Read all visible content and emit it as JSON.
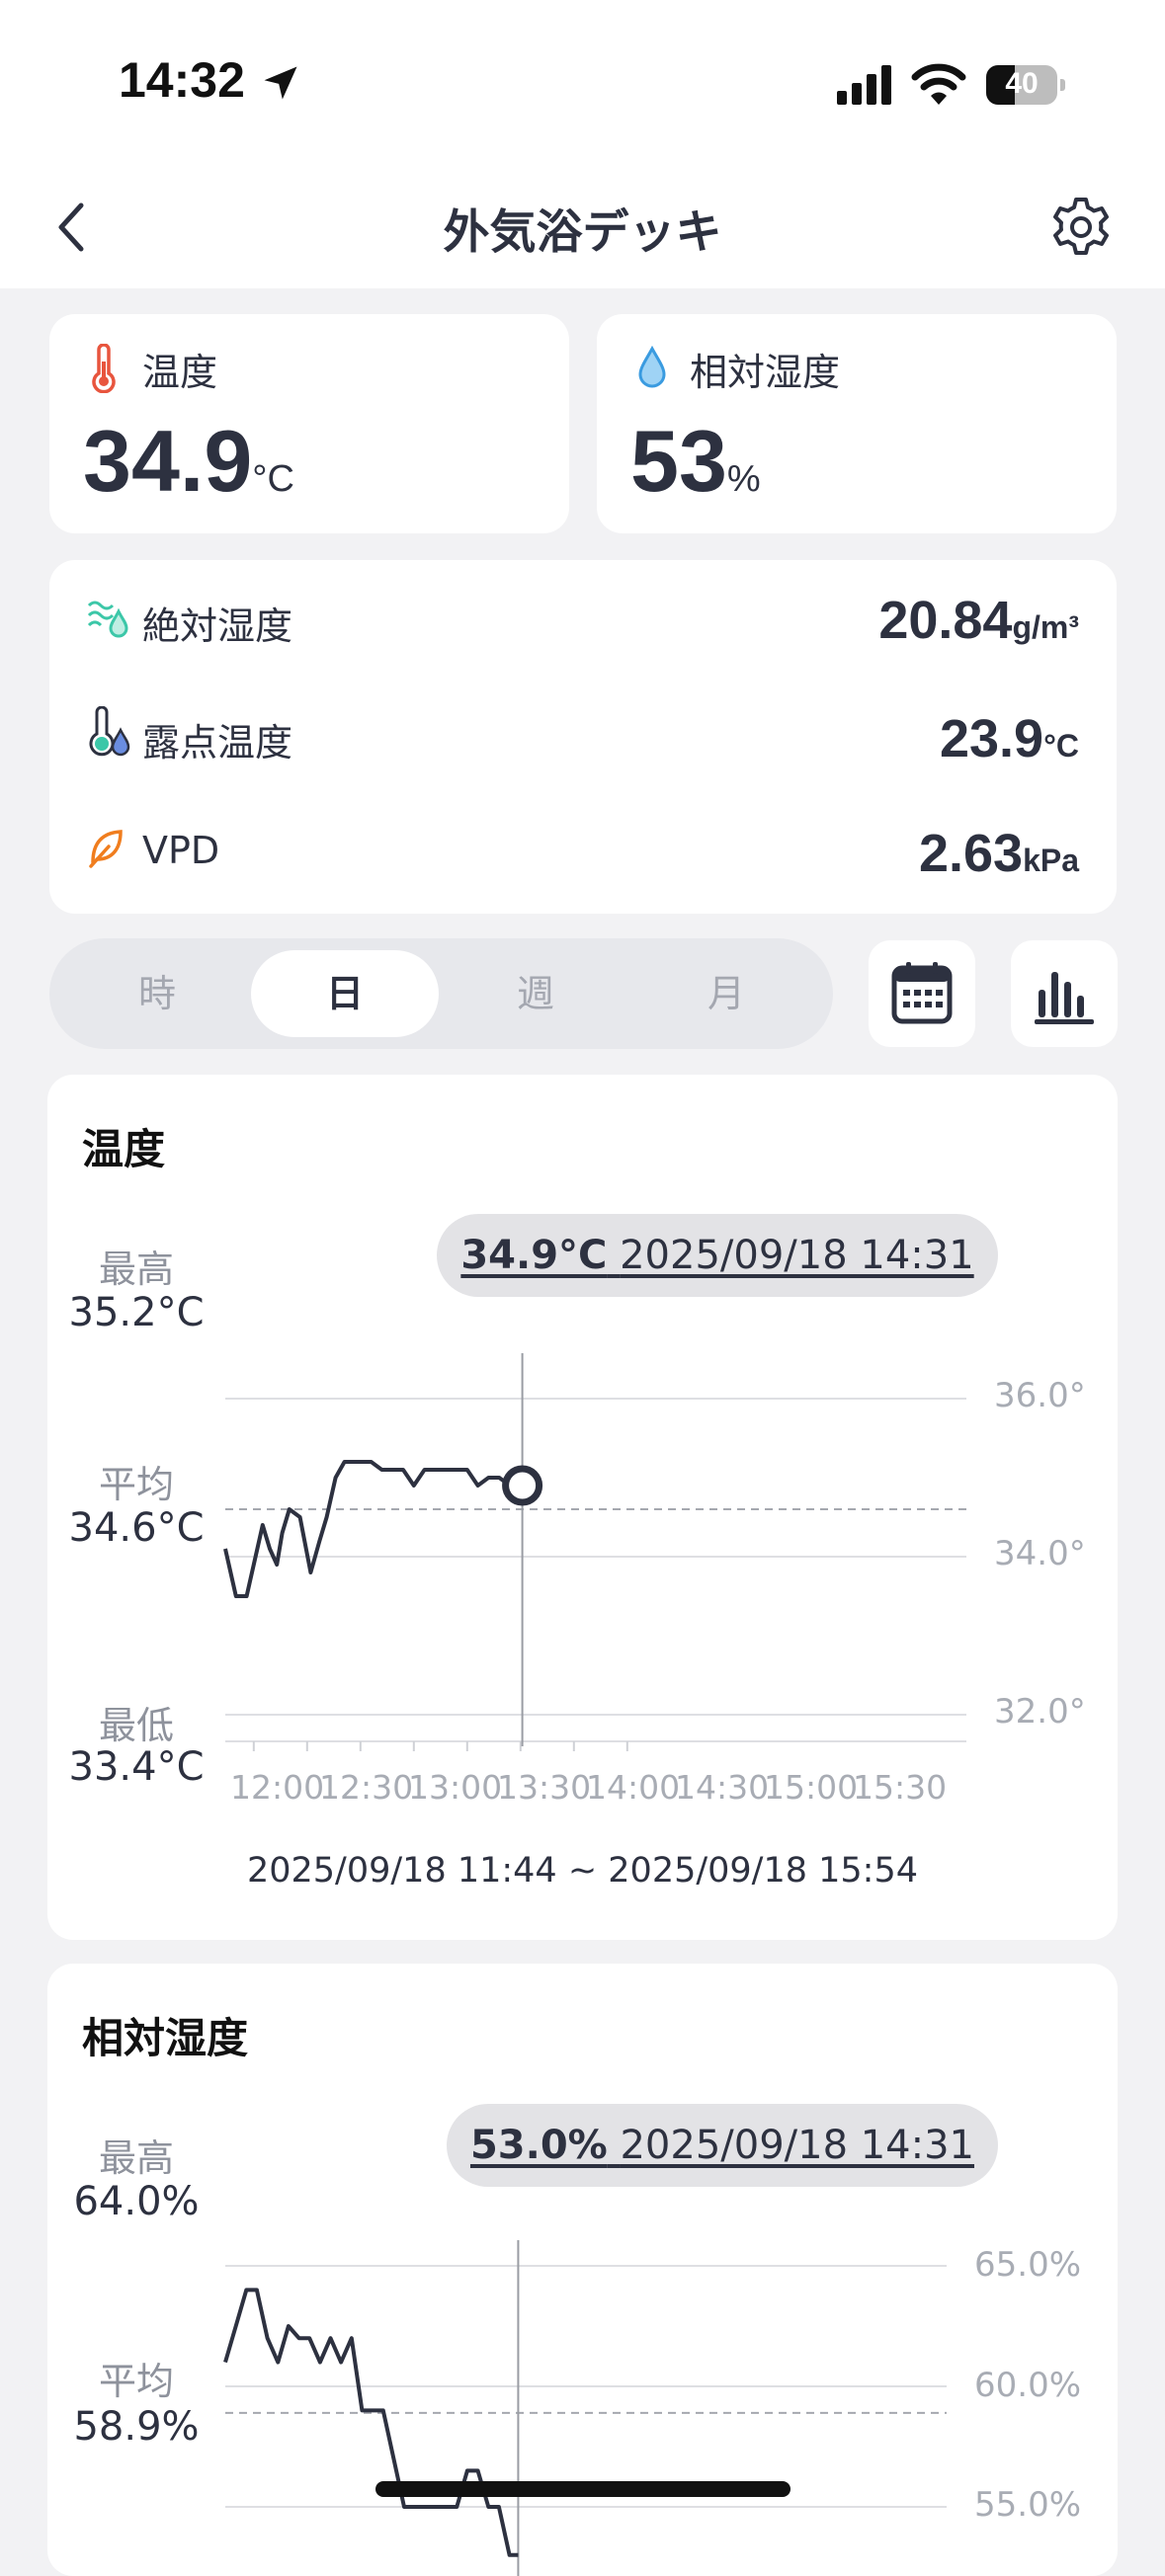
{
  "status_bar": {
    "time": "14:32",
    "battery": "40"
  },
  "nav": {
    "title": "外気浴デッキ"
  },
  "temperature_card": {
    "label": "温度",
    "value": "34.9",
    "unit": "°C"
  },
  "humidity_card": {
    "label": "相対湿度",
    "value": "53",
    "unit": "%"
  },
  "metrics": [
    {
      "label": "絶対湿度",
      "value": "20.84",
      "unit": "g/m³",
      "icon": "humidity-waves-icon"
    },
    {
      "label": "露点温度",
      "value": "23.9",
      "unit": "°C",
      "icon": "dew-point-icon"
    },
    {
      "label": "VPD",
      "value": "2.63",
      "unit": "kPa",
      "icon": "leaf-icon"
    }
  ],
  "period_tabs": [
    {
      "label": "時",
      "active": false
    },
    {
      "label": "日",
      "active": true
    },
    {
      "label": "週",
      "active": false
    },
    {
      "label": "月",
      "active": false
    }
  ],
  "temp_chart": {
    "title": "温度",
    "max_label": "最高",
    "max_value": "35.2°C",
    "avg_label": "平均",
    "avg_value": "34.6°C",
    "min_label": "最低",
    "min_value": "33.4°C",
    "tooltip_value": "34.9°C",
    "tooltip_time": "2025/09/18 14:31",
    "y_ticks": [
      "36.0°",
      "34.0°",
      "32.0°"
    ],
    "x_ticks": [
      "12:00",
      "12:30",
      "13:00",
      "13:30",
      "14:00",
      "14:30",
      "15:00",
      "15:30"
    ],
    "range": "2025/09/18 11:44 ~ 2025/09/18 15:54"
  },
  "humidity_chart": {
    "title": "相対湿度",
    "max_label": "最高",
    "max_value": "64.0%",
    "avg_label": "平均",
    "avg_value": "58.9%",
    "tooltip_value": "53.0%",
    "tooltip_time": "2025/09/18 14:31",
    "y_ticks": [
      "65.0%",
      "60.0%",
      "55.0%"
    ]
  },
  "chart_data": [
    {
      "type": "line",
      "title": "温度",
      "ylim": [
        32.0,
        36.0
      ],
      "series": [
        {
          "x": [
            "11:44",
            "11:50",
            "11:56",
            "12:00",
            "12:05",
            "12:09",
            "12:13",
            "12:16",
            "12:20",
            "12:26",
            "12:32",
            "12:37",
            "12:41",
            "12:46",
            "12:51",
            "12:56",
            "13:00",
            "13:06",
            "13:12",
            "13:18",
            "13:24",
            "13:30",
            "13:36",
            "13:42",
            "13:48",
            "13:54",
            "14:00",
            "14:06",
            "14:12",
            "14:18",
            "14:24",
            "14:31"
          ],
          "y": [
            34.1,
            33.5,
            33.5,
            33.9,
            34.4,
            34.1,
            33.9,
            34.3,
            34.6,
            34.5,
            33.8,
            34.2,
            34.5,
            35.0,
            35.2,
            35.2,
            35.2,
            35.2,
            35.1,
            35.1,
            35.1,
            34.9,
            35.1,
            35.1,
            35.1,
            35.1,
            35.1,
            34.9,
            35.0,
            35.0,
            34.9,
            34.9
          ]
        }
      ],
      "avg": 34.6,
      "highlight": {
        "x": "14:31",
        "y": 34.9
      }
    },
    {
      "type": "line",
      "title": "相対湿度",
      "ylim": [
        55.0,
        65.0
      ],
      "series": [
        {
          "x": [
            "11:44",
            "11:50",
            "11:56",
            "12:02",
            "12:08",
            "12:14",
            "12:20",
            "12:26",
            "12:32",
            "12:38",
            "12:44",
            "12:50",
            "12:56",
            "13:02",
            "13:08",
            "13:14",
            "13:20",
            "13:26",
            "13:32",
            "13:38",
            "13:44",
            "13:50",
            "13:56",
            "14:02",
            "14:08",
            "14:14",
            "14:20",
            "14:26",
            "14:31"
          ],
          "y": [
            61.0,
            62.5,
            64.0,
            64.0,
            62.0,
            61.0,
            62.5,
            62.0,
            62.0,
            61.0,
            62.0,
            61.0,
            62.0,
            59.0,
            59.0,
            59.0,
            57.0,
            55.0,
            55.0,
            55.0,
            55.0,
            55.0,
            55.0,
            56.5,
            56.5,
            55.0,
            55.0,
            53.0,
            53.0
          ]
        }
      ],
      "avg": 58.9,
      "highlight": {
        "x": "14:31",
        "y": 53.0
      }
    }
  ]
}
